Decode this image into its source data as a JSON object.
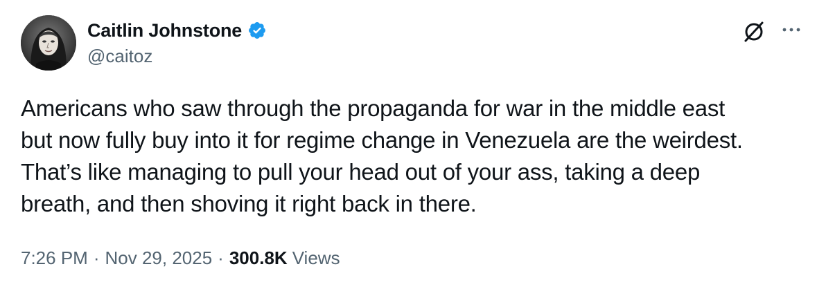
{
  "author": {
    "display_name": "Caitlin Johnstone",
    "handle": "@caitoz",
    "verified": true,
    "avatar_icon": "avatar-portrait",
    "verified_color": "#1d9bf0"
  },
  "actions": {
    "grok_icon": "grok-icon",
    "more_icon": "more-icon"
  },
  "tweet": {
    "text": "Americans who saw through the propaganda for war in the middle east\nbut now fully buy into it for regime change in Venezuela are the weirdest.\nThat’s like managing to pull your head out of your ass, taking a deep\nbreath, and then shoving it right back in there."
  },
  "meta": {
    "time": "7:26 PM",
    "separator": "·",
    "date": "Nov 29, 2025",
    "views_count": "300.8K",
    "views_label": "Views"
  },
  "colors": {
    "text_primary": "#0f1419",
    "text_secondary": "#536471",
    "accent": "#1d9bf0",
    "background": "#ffffff"
  }
}
